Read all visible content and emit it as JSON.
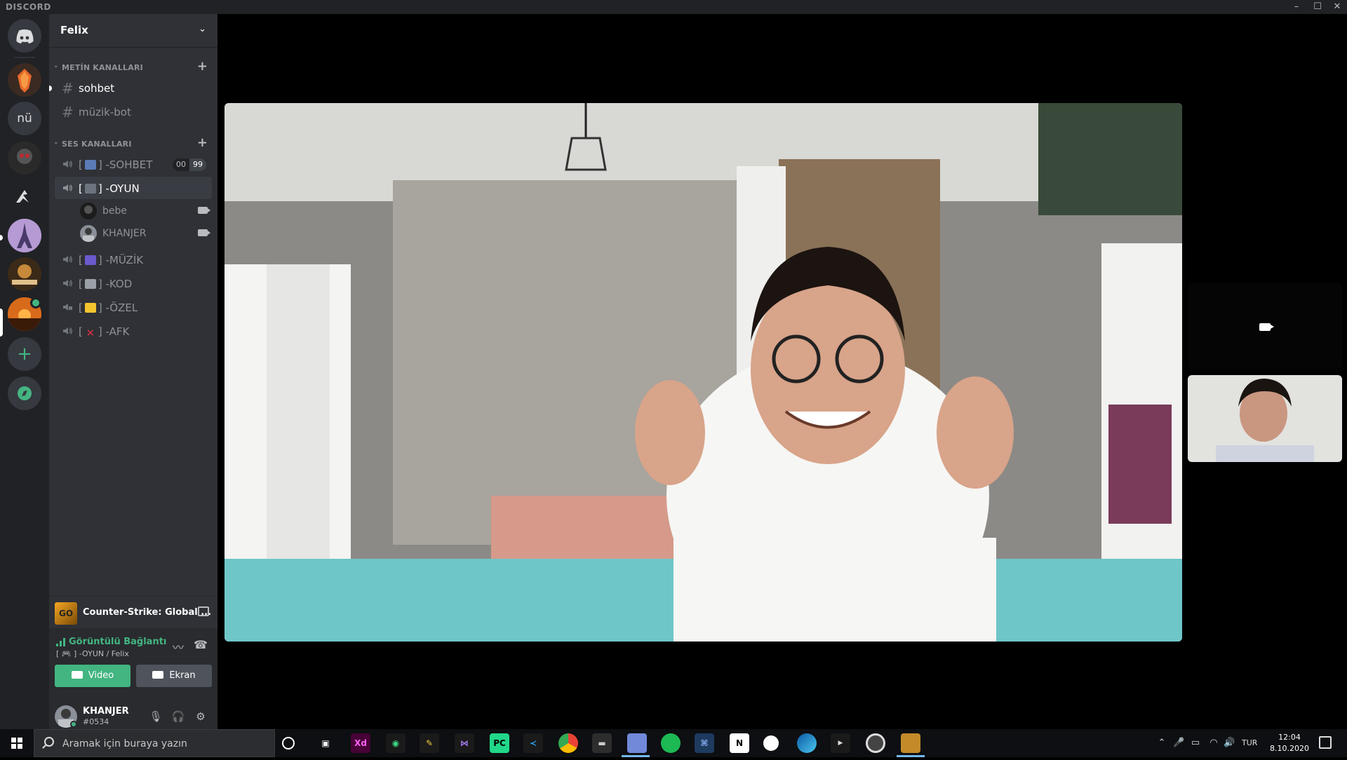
{
  "app": {
    "brand": "DISCORD"
  },
  "window_controls": {
    "minimize": "–",
    "maximize": "☐",
    "close": "✕"
  },
  "rail": {
    "server_nu_label": "nü",
    "add_label": "+"
  },
  "guild": {
    "name": "Felix"
  },
  "text_category": {
    "label": "METİN KANALLARI"
  },
  "text_channels": [
    {
      "name": "sohbet"
    },
    {
      "name": "müzik-bot"
    }
  ],
  "voice_category": {
    "label": "SES KANALLARI"
  },
  "voice_channels": [
    {
      "prefix": "[",
      "suffix": "] -SOHBET",
      "emoji": "speaker",
      "limit_current": "00",
      "limit_max": "99"
    },
    {
      "prefix": "[",
      "suffix": "] -OYUN",
      "emoji": "gamepad"
    },
    {
      "prefix": "[",
      "suffix": "] -MÜZİK",
      "emoji": "music"
    },
    {
      "prefix": "[",
      "suffix": "] -KOD",
      "emoji": "laptop"
    },
    {
      "prefix": "[",
      "suffix": "] -ÖZEL",
      "emoji": "lock"
    },
    {
      "prefix": "[",
      "suffix": "] -AFK",
      "emoji": "cross"
    }
  ],
  "voice_users": [
    {
      "name": "bebe"
    },
    {
      "name": "KHANJER"
    }
  ],
  "activity": {
    "game": "Counter-Strike: Global ...",
    "icon_text": "GO"
  },
  "voice_panel": {
    "status": "Görüntülü Bağlantı Ku",
    "channel": "[ 🎮 ] -OYUN / Felix",
    "video_label": "Video",
    "screen_label": "Ekran"
  },
  "user": {
    "name": "KHANJER",
    "tag": "#0534"
  },
  "taskbar": {
    "search_placeholder": "Aramak için buraya yazın",
    "apps": [
      "Xd",
      "PC",
      "N"
    ],
    "lang": "TUR",
    "time": "12:04",
    "date": "8.10.2020"
  },
  "colors": {
    "accent_green": "#43b581",
    "sidebar_bg": "#2f3136",
    "rail_bg": "#202225",
    "discord_blurple": "#7289da"
  }
}
